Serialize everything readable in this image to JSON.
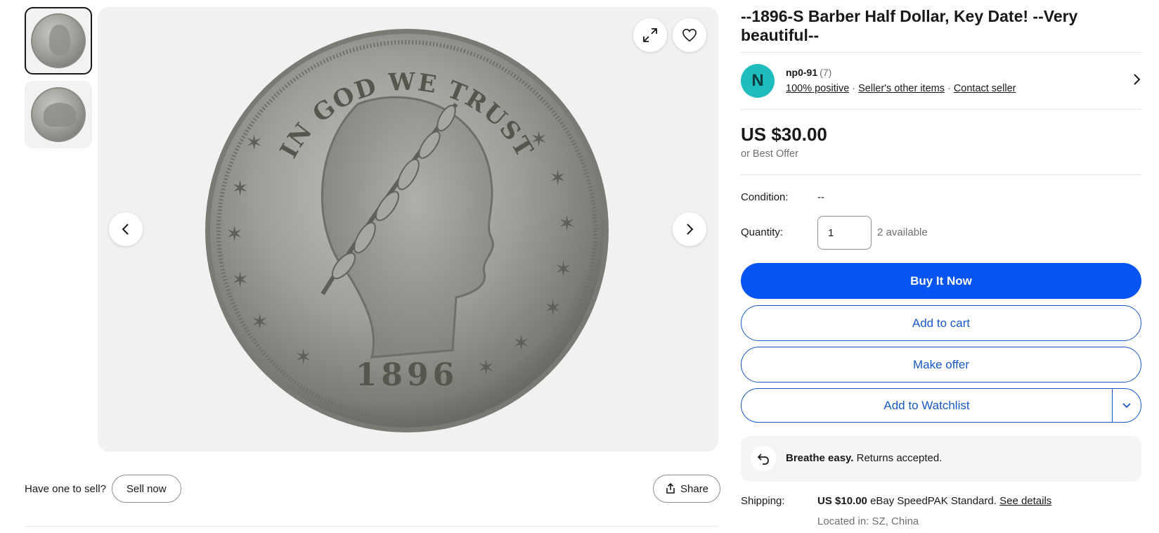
{
  "gallery": {
    "thumbnails": [
      {
        "name": "obverse"
      },
      {
        "name": "reverse"
      }
    ],
    "coin_legend": "IN GOD WE TRUST",
    "coin_year": "1896"
  },
  "below_image": {
    "sell_prompt": "Have one to sell?",
    "sell_button": "Sell now",
    "share_button": "Share"
  },
  "listing": {
    "title": "--1896-S Barber Half Dollar, Key Date! --Very beautiful--"
  },
  "seller": {
    "avatar_letter": "N",
    "name": "np0-91",
    "feedback_count": "(7)",
    "positive": "100% positive",
    "other_items": "Seller's other items",
    "contact": "Contact seller",
    "avatar_color": "#1fbcbe"
  },
  "price": {
    "amount": "US $30.00",
    "best_offer": "or Best Offer"
  },
  "details": {
    "condition_label": "Condition:",
    "condition_value": "--",
    "quantity_label": "Quantity:",
    "quantity_value": "1",
    "available": "2 available"
  },
  "actions": {
    "buy_now": "Buy It Now",
    "add_to_cart": "Add to cart",
    "make_offer": "Make offer",
    "add_to_watchlist": "Add to Watchlist",
    "primary_color": "#0654f2",
    "secondary_color": "#1758c7"
  },
  "returns": {
    "bold": "Breathe easy.",
    "text": "Returns accepted."
  },
  "shipping": {
    "label": "Shipping:",
    "cost": "US $10.00",
    "method": "eBay SpeedPAK Standard.",
    "details_link": "See details",
    "located": "Located in: SZ, China"
  }
}
